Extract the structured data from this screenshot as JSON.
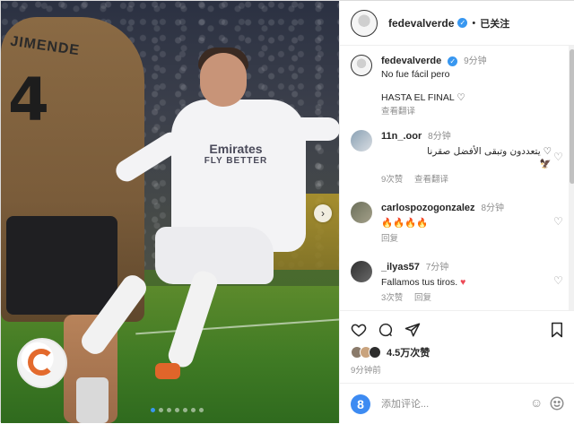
{
  "header": {
    "username": "fedevalverde",
    "separator": "•",
    "follow_status": "已关注"
  },
  "comments": [
    {
      "username": "fedevalverde",
      "time": "9分钟",
      "text": "No fue fácil pero",
      "text2": "HASTA EL FINAL",
      "translate": "查看翻译"
    },
    {
      "username": "11n_.oor",
      "time": "8分钟",
      "text": "يتعددون وتبقى الأفضل صقرنا",
      "likes": "9次赞",
      "translate": "查看翻译"
    },
    {
      "username": "carlospozogonzalez",
      "time": "8分钟",
      "text": "🔥🔥🔥🔥",
      "reply": "回复"
    },
    {
      "username": "_ilyas57",
      "time": "7分钟",
      "text": "Fallamos tus tiros.",
      "likes": "3次赞",
      "reply": "回复"
    }
  ],
  "actions": {
    "likes_count": "4.5万次赞",
    "posted_time": "9分钟前"
  },
  "composer": {
    "placeholder": "添加评论..."
  },
  "media": {
    "jersey_sponsor": "Emirates",
    "jersey_sub": "FLY BETTER",
    "opponent_number": "4",
    "opponent_name": "JIMENDE"
  },
  "colors": {
    "link_blue": "#3897f0",
    "like_red": "#ed4956",
    "text_primary": "#262626",
    "text_secondary": "#8e8e8e"
  }
}
